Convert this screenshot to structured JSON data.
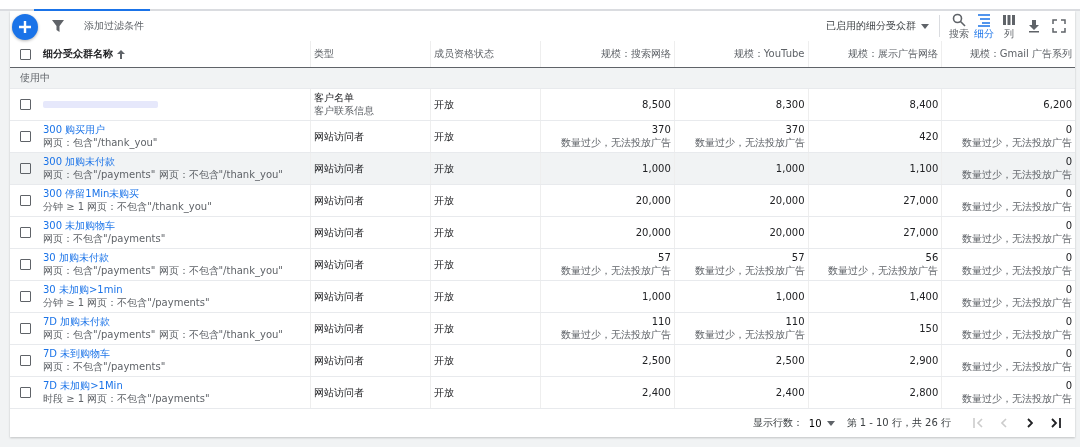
{
  "toolbar": {
    "filter_placeholder": "添加过滤条件",
    "segment_dropdown": "已启用的细分受众群",
    "tools": [
      {
        "kind": "search",
        "label": "搜索",
        "selected": false
      },
      {
        "kind": "segment",
        "label": "细分",
        "selected": true
      },
      {
        "kind": "columns",
        "label": "列",
        "selected": false
      },
      {
        "kind": "download",
        "selected": false
      },
      {
        "kind": "expand",
        "selected": false
      }
    ]
  },
  "table": {
    "select_all_checked": false,
    "columns": [
      {
        "label": "细分受众群名称",
        "sorted_ascending": true
      },
      {
        "label": "类型"
      },
      {
        "label": "成员资格状态"
      },
      {
        "label": "规模：搜索网络"
      },
      {
        "label": "规模：YouTube"
      },
      {
        "label": "规模：展示广告网络"
      },
      {
        "label": "规模：Gmail 广告系列"
      }
    ],
    "group": "使用中",
    "rows": [
      {
        "checked": false,
        "hovered": false,
        "kind": "redacted",
        "type": [
          "客户名单",
          "客户联系信息"
        ],
        "status": "开放",
        "sizes": [
          {
            "value": "8,500"
          },
          {
            "value": "8,300"
          },
          {
            "value": "8,400"
          },
          {
            "value": "6,200"
          }
        ]
      },
      {
        "checked": false,
        "hovered": false,
        "name": "300 购买用户",
        "rule": "网页：包含\"/thank_you\"",
        "type": [
          "网站访问者"
        ],
        "status": "开放",
        "sizes": [
          {
            "value": "370",
            "note": "数量过少，无法投放广告"
          },
          {
            "value": "370",
            "note": "数量过少，无法投放广告"
          },
          {
            "value": "420"
          },
          {
            "value": "0",
            "note": "数量过少，无法投放广告"
          }
        ]
      },
      {
        "checked": false,
        "hovered": true,
        "name": "300 加购未付款",
        "rule": "网页：包含\"/payments\" 网页：不包含\"/thank_you\"",
        "type": [
          "网站访问者"
        ],
        "status": "开放",
        "sizes": [
          {
            "value": "1,000"
          },
          {
            "value": "1,000"
          },
          {
            "value": "1,100"
          },
          {
            "value": "0",
            "note": "数量过少，无法投放广告"
          }
        ]
      },
      {
        "checked": false,
        "hovered": false,
        "name": "300 停留1Min未购买",
        "rule": "分钟 ≥ 1 网页：不包含\"/thank_you\"",
        "type": [
          "网站访问者"
        ],
        "status": "开放",
        "sizes": [
          {
            "value": "20,000"
          },
          {
            "value": "20,000"
          },
          {
            "value": "27,000"
          },
          {
            "value": "0",
            "note": "数量过少，无法投放广告"
          }
        ]
      },
      {
        "checked": false,
        "hovered": false,
        "name": "300 未加购物车",
        "rule": "网页：不包含\"/payments\"",
        "type": [
          "网站访问者"
        ],
        "status": "开放",
        "sizes": [
          {
            "value": "20,000"
          },
          {
            "value": "20,000"
          },
          {
            "value": "27,000"
          },
          {
            "value": "0",
            "note": "数量过少，无法投放广告"
          }
        ]
      },
      {
        "checked": false,
        "hovered": false,
        "name": "30 加购未付款",
        "rule": "网页：包含\"/payments\" 网页：不包含\"/thank_you\"",
        "type": [
          "网站访问者"
        ],
        "status": "开放",
        "sizes": [
          {
            "value": "57",
            "note": "数量过少，无法投放广告"
          },
          {
            "value": "57",
            "note": "数量过少，无法投放广告"
          },
          {
            "value": "56",
            "note": "数量过少，无法投放广告"
          },
          {
            "value": "0",
            "note": "数量过少，无法投放广告"
          }
        ]
      },
      {
        "checked": false,
        "hovered": false,
        "name": "30 未加购>1min",
        "rule": "分钟 ≥ 1 网页：不包含\"/payments\"",
        "type": [
          "网站访问者"
        ],
        "status": "开放",
        "sizes": [
          {
            "value": "1,000"
          },
          {
            "value": "1,000"
          },
          {
            "value": "1,400"
          },
          {
            "value": "0",
            "note": "数量过少，无法投放广告"
          }
        ]
      },
      {
        "checked": false,
        "hovered": false,
        "name": "7D 加购未付款",
        "rule": "网页：包含\"/payments\" 网页：不包含\"/thank_you\"",
        "type": [
          "网站访问者"
        ],
        "status": "开放",
        "sizes": [
          {
            "value": "110",
            "note": "数量过少，无法投放广告"
          },
          {
            "value": "110",
            "note": "数量过少，无法投放广告"
          },
          {
            "value": "150"
          },
          {
            "value": "0",
            "note": "数量过少，无法投放广告"
          }
        ]
      },
      {
        "checked": false,
        "hovered": false,
        "name": "7D 未到购物车",
        "rule": "网页：不包含\"/payments\"",
        "type": [
          "网站访问者"
        ],
        "status": "开放",
        "sizes": [
          {
            "value": "2,500"
          },
          {
            "value": "2,500"
          },
          {
            "value": "2,900"
          },
          {
            "value": "0",
            "note": "数量过少，无法投放广告"
          }
        ]
      },
      {
        "checked": false,
        "hovered": false,
        "name": "7D 未加购>1Min",
        "rule": "时段 ≥ 1 网页：不包含\"/payments\"",
        "type": [
          "网站访问者"
        ],
        "status": "开放",
        "sizes": [
          {
            "value": "2,400"
          },
          {
            "value": "2,400"
          },
          {
            "value": "2,800"
          },
          {
            "value": "0",
            "note": "数量过少，无法投放广告"
          }
        ]
      }
    ]
  },
  "pagination": {
    "rows_label": "显示行数：",
    "rows_value": "10",
    "range": "第 1 - 10 行，共 26 行",
    "first_disabled": true,
    "prev_disabled": true,
    "next_disabled": false,
    "last_disabled": false
  }
}
